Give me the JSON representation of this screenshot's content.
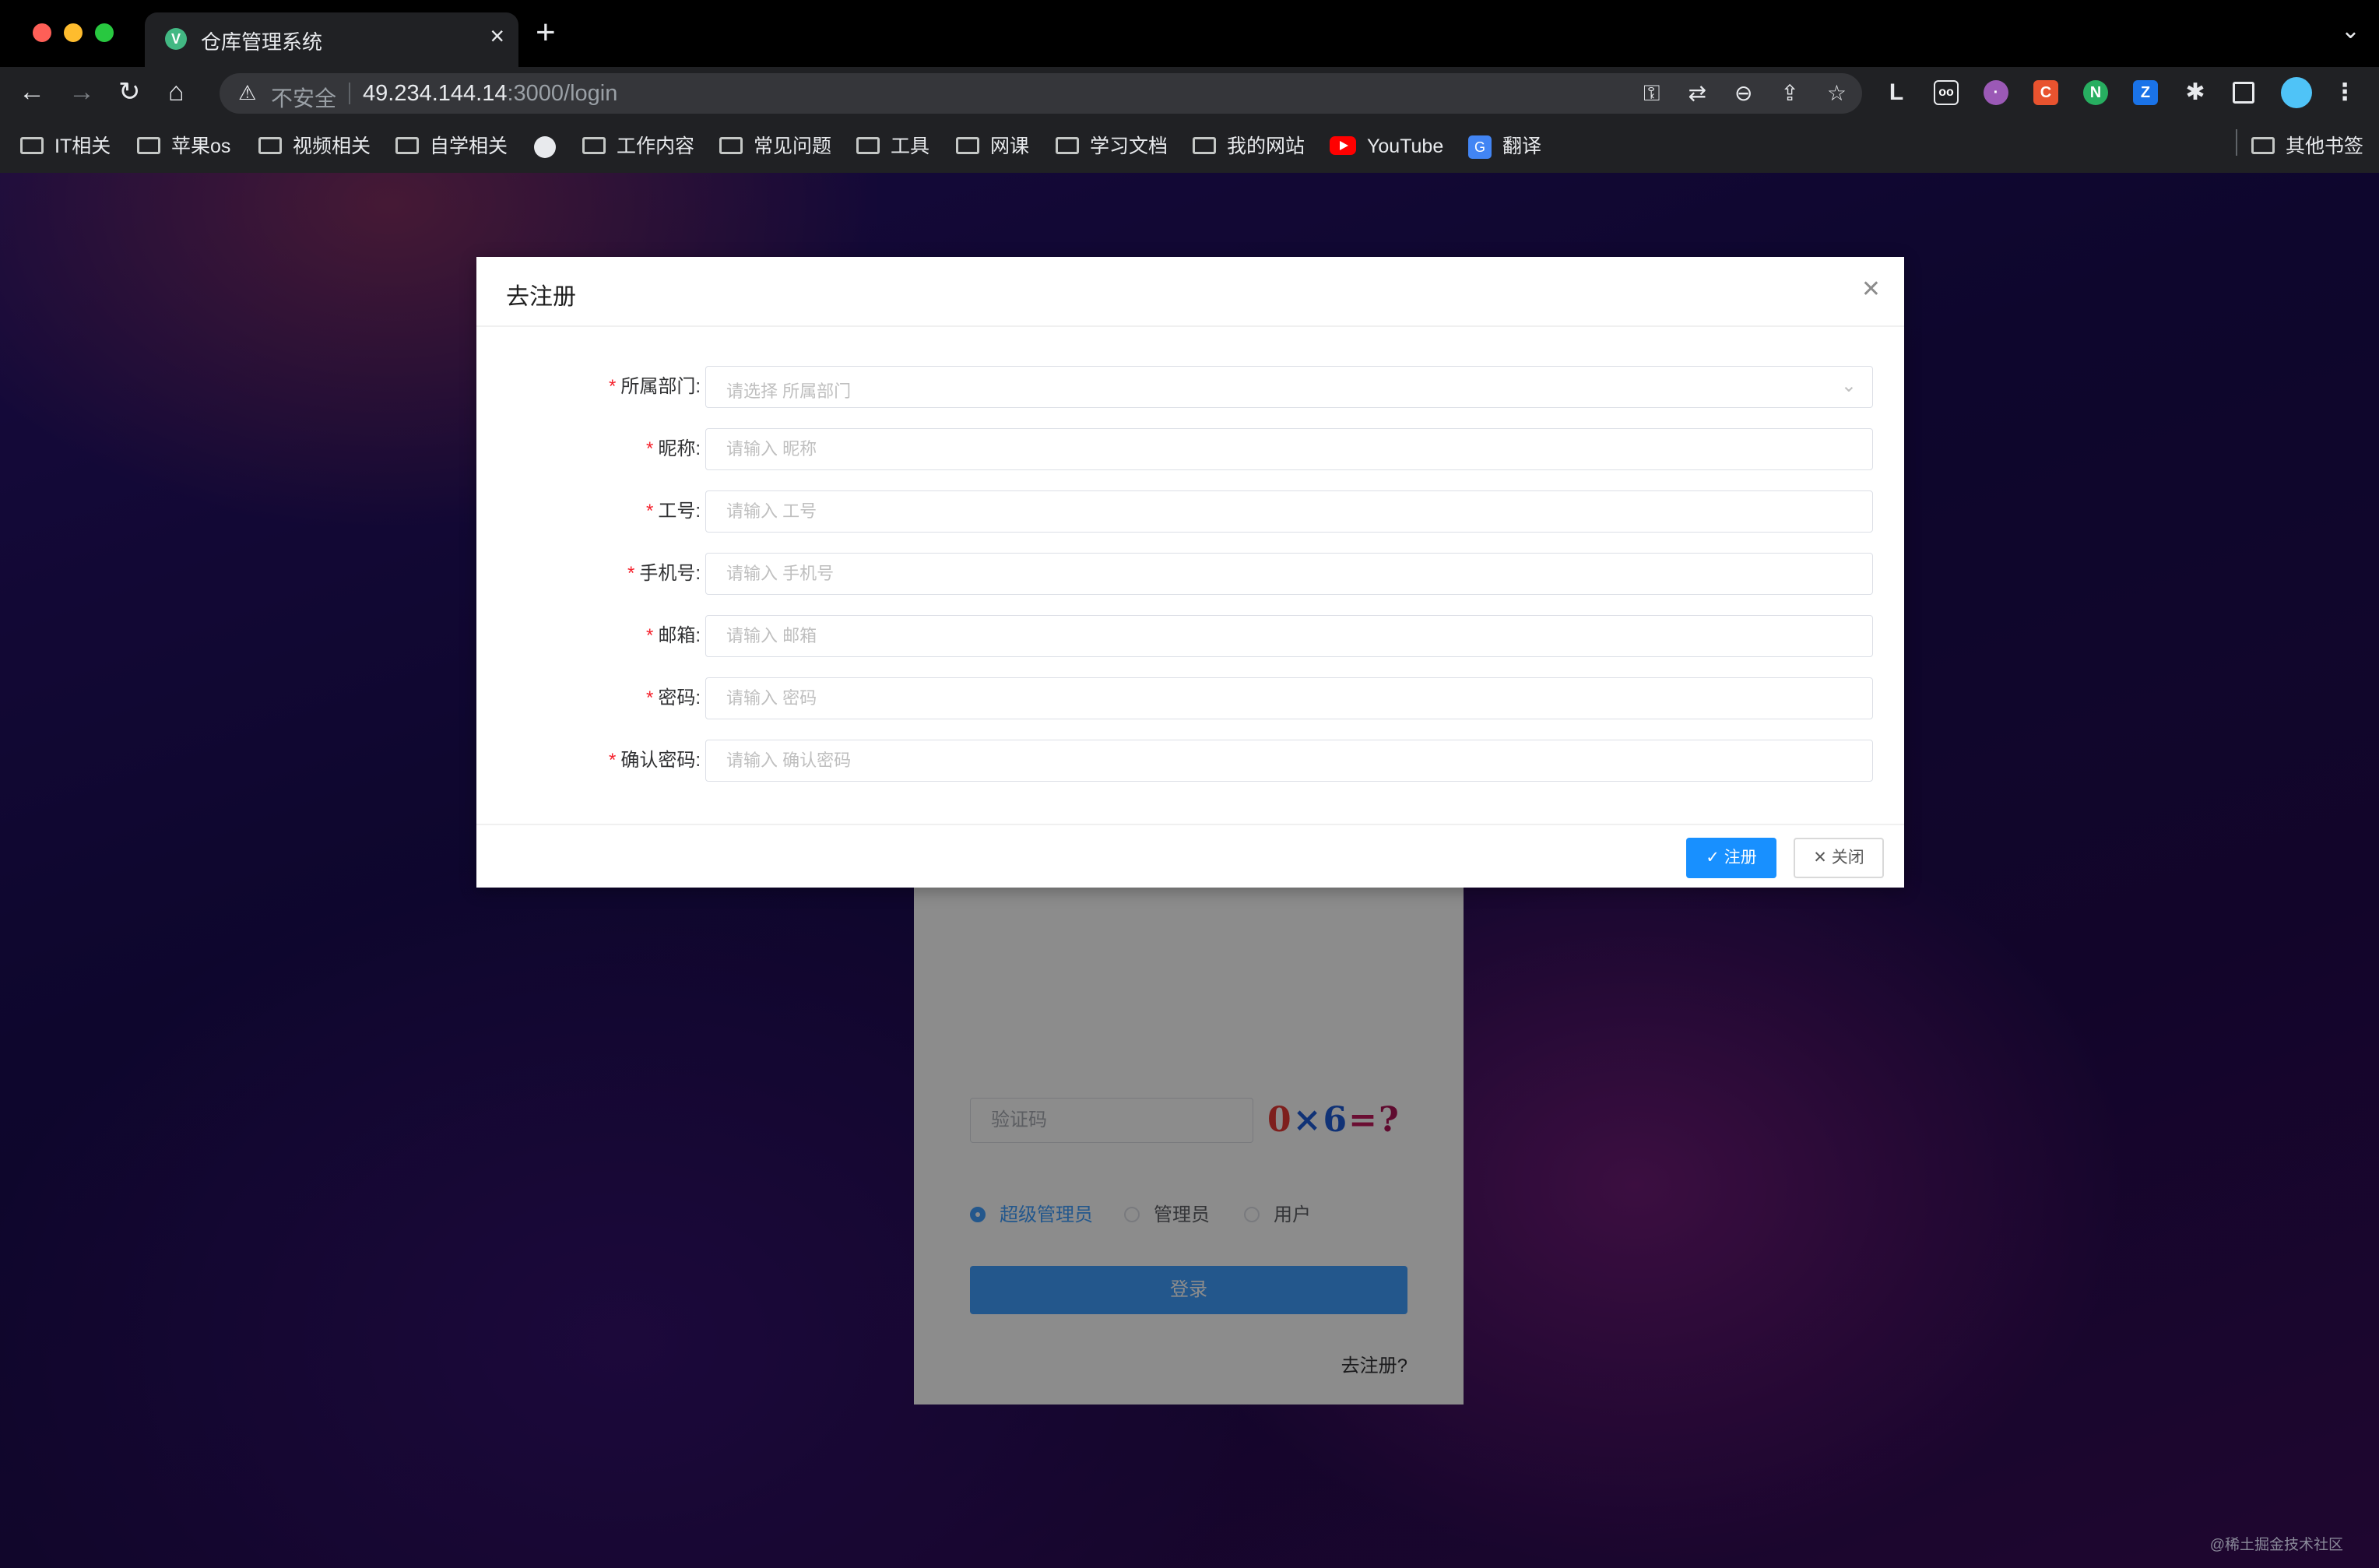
{
  "browser": {
    "tab_title": "仓库管理系统",
    "tab_favicon": "V",
    "new_tab": "+",
    "omnibox": {
      "security_label": "不安全",
      "url_host": "49.234.144.14",
      "url_path": ":3000/login"
    },
    "bookmarks": [
      {
        "label": "IT相关",
        "icon": "folder-icon"
      },
      {
        "label": "苹果os",
        "icon": "folder-icon"
      },
      {
        "label": "视频相关",
        "icon": "folder-icon"
      },
      {
        "label": "自学相关",
        "icon": "folder-icon"
      },
      {
        "label": "",
        "icon": "globe-icon"
      },
      {
        "label": "工作内容",
        "icon": "folder-icon"
      },
      {
        "label": "常见问题",
        "icon": "folder-icon"
      },
      {
        "label": "工具",
        "icon": "folder-icon"
      },
      {
        "label": "网课",
        "icon": "folder-icon"
      },
      {
        "label": "学习文档",
        "icon": "folder-icon"
      },
      {
        "label": "我的网站",
        "icon": "folder-icon"
      },
      {
        "label": "YouTube",
        "icon": "youtube-icon"
      },
      {
        "label": "翻译",
        "icon": "translate-icon"
      }
    ],
    "other_bookmarks": "其他书签"
  },
  "login": {
    "captcha_placeholder": "验证码",
    "captcha_text": "0×6=?",
    "roles": [
      "超级管理员",
      "管理员",
      "用户"
    ],
    "selected_role": "超级管理员",
    "login_button": "登录",
    "register_link": "去注册?"
  },
  "modal": {
    "title": "去注册",
    "fields": {
      "department": {
        "label": "所属部门:",
        "placeholder": "请选择 所属部门"
      },
      "nickname": {
        "label": "昵称:",
        "placeholder": "请输入 昵称"
      },
      "employee_id": {
        "label": "工号:",
        "placeholder": "请输入 工号"
      },
      "phone": {
        "label": "手机号:",
        "placeholder": "请输入 手机号"
      },
      "email": {
        "label": "邮箱:",
        "placeholder": "请输入 邮箱"
      },
      "password": {
        "label": "密码:",
        "placeholder": "请输入 密码"
      },
      "confirm_password": {
        "label": "确认密码:",
        "placeholder": "请输入 确认密码"
      }
    },
    "required_mark": "*",
    "register_button": "✓ 注册",
    "close_button": "✕ 关闭"
  },
  "watermark": "@稀土掘金技术社区",
  "colors": {
    "primary": "#1890ff",
    "login_primary": "#409eff",
    "required": "#f5222d"
  }
}
